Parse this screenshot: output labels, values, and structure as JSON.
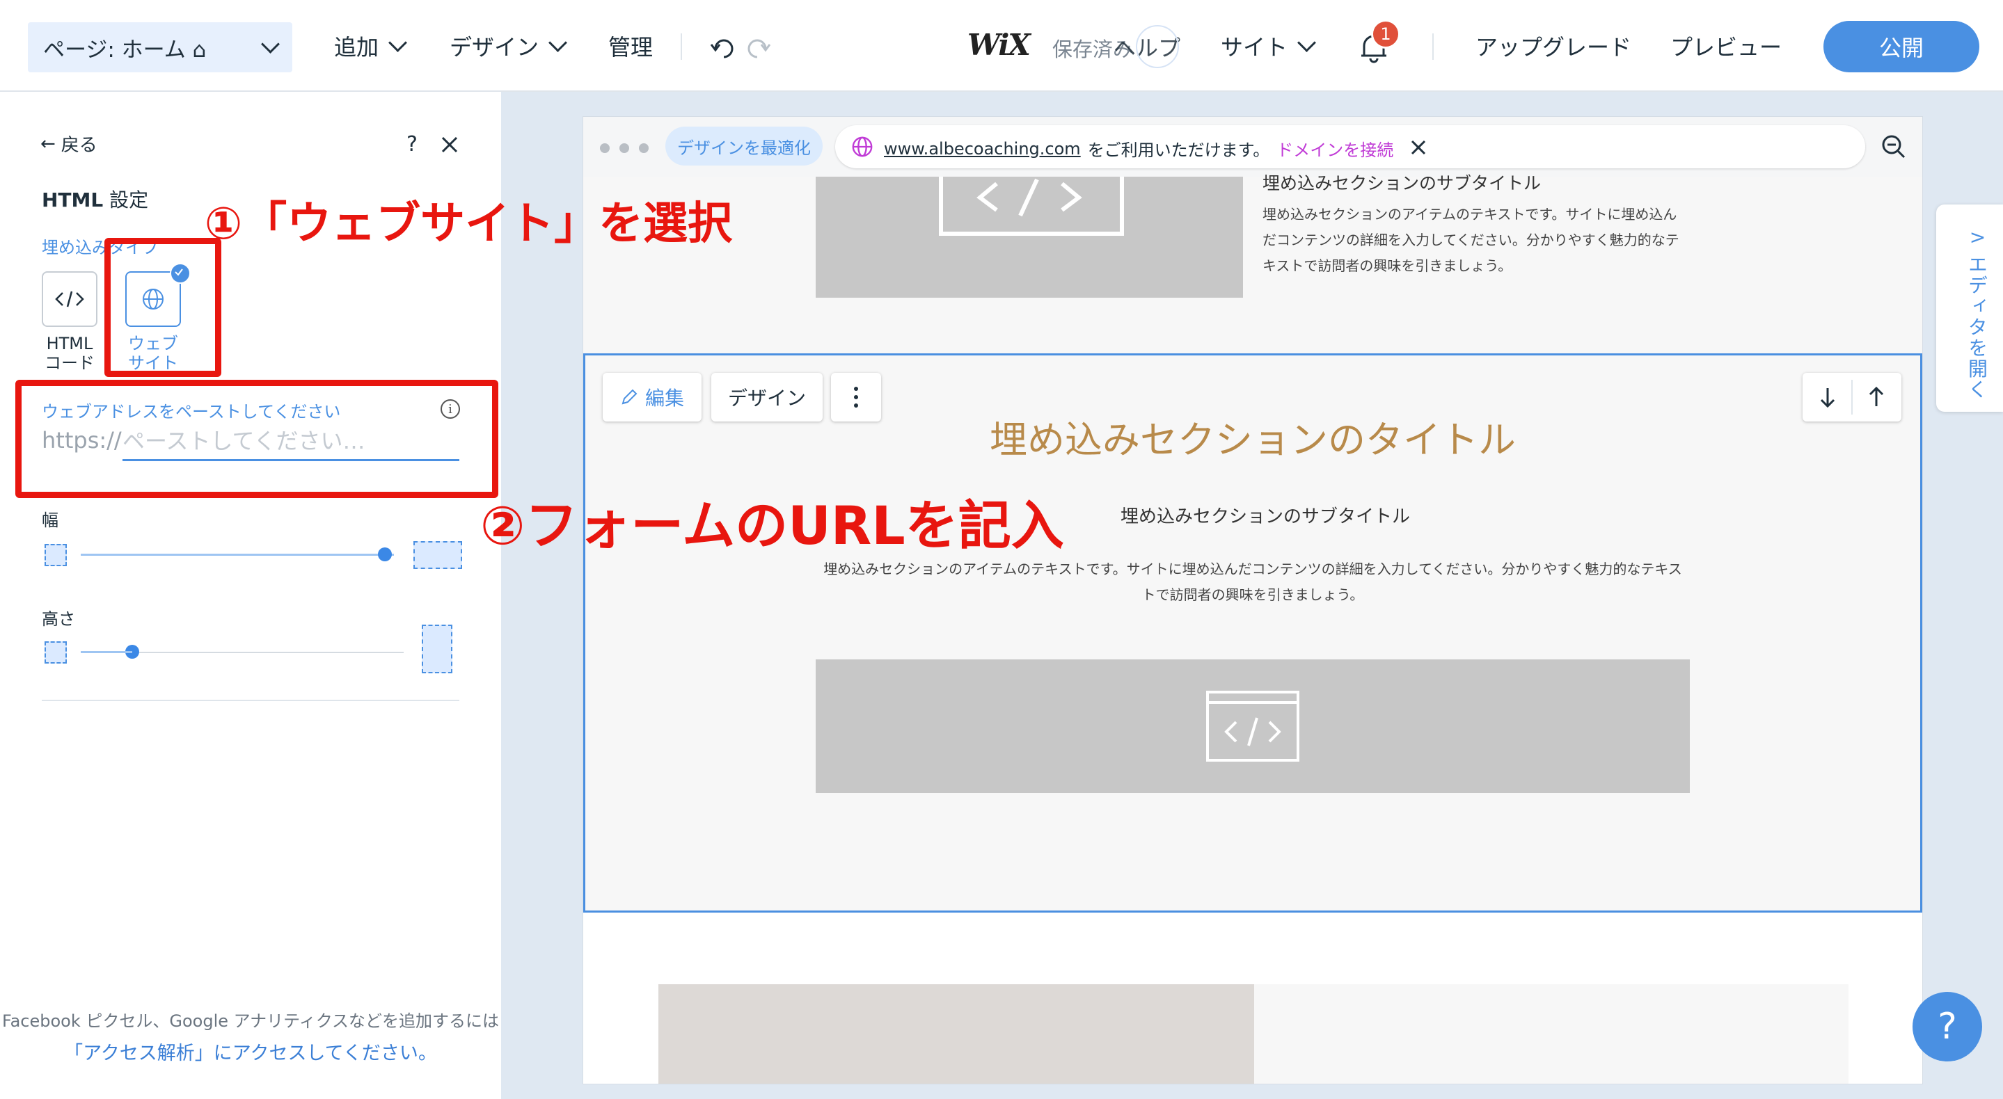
{
  "topbar": {
    "page_select": "ページ: ホーム ⌂",
    "menu": {
      "add": "追加",
      "design": "デザイン",
      "manage": "管理"
    },
    "logo": "WiX",
    "saved": "保存済み",
    "help": "ヘルプ",
    "site": "サイト",
    "notification_count": "1",
    "upgrade": "アップグレード",
    "preview": "プレビュー",
    "publish": "公開"
  },
  "panel": {
    "back": "戻る",
    "help": "?",
    "title_bold": "HTML",
    "title_rest": " 設定",
    "type_label": "埋め込みタイプ",
    "type_html_line1": "HTML",
    "type_html_line2": "コード",
    "type_web_line1": "ウェブ",
    "type_web_line2": "サイト",
    "url_label": "ウェブアドレスをペーストしてください",
    "url_prefix": "https://",
    "url_placeholder": "ペーストしてください…",
    "url_value": "",
    "width_label": "幅",
    "width_value": 0.97,
    "height_label": "高さ",
    "height_value": 0.16,
    "footnote": "Facebook ピクセル、Google アナリティクスなどを追加するには",
    "footlink": "「アクセス解析」にアクセスしてください。"
  },
  "browser": {
    "optimize": "デザインを最適化",
    "domain": "www.albecoaching.com",
    "available": "をご利用いただけます。",
    "connect": "ドメインを接続"
  },
  "site": {
    "top_subtitle": "埋め込みセクションのサブタイトル",
    "top_body_1": "埋め込みセクションのアイテムのテキストです。サイトに埋め込ん",
    "top_body_2": "だコンテンツの詳細を入力してください。分かりやすく魅力的なテ",
    "top_body_3": "キストで訪問者の興味を引きましょう。",
    "edit": "編集",
    "design": "デザイン",
    "section_title": "埋め込みセクションのタイトル",
    "section_subtitle": "埋め込みセクションのサブタイトル",
    "section_body_1": "埋め込みセクションのアイテムのテキストです。サイトに埋め込んだコンテンツの詳細を入力してください。分かりやすく魅力的なテキス",
    "section_body_2": "トで訪問者の興味を引きましょう。"
  },
  "side_tab": "エディタを開く",
  "help_fab": "?",
  "annotations": {
    "step1": "①「ウェブサイト」を選択",
    "step2": "②フォームのURLを記入"
  },
  "colors": {
    "accent": "#4a90e2",
    "annotation": "#e8160f",
    "title_gold": "#b88a4a",
    "badge": "#e0503a"
  }
}
